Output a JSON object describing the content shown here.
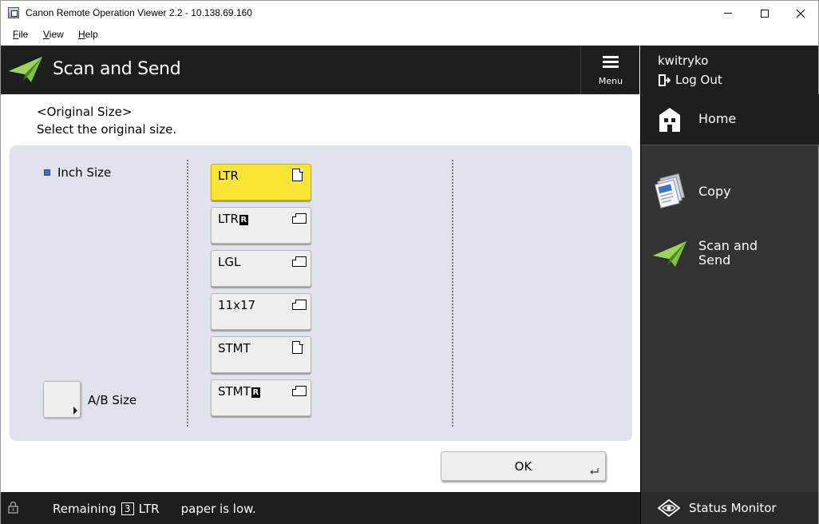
{
  "window": {
    "title": "Canon Remote Operation Viewer 2.2 - 10.138.69.160"
  },
  "menubar": {
    "file": "File",
    "view": "View",
    "help": "Help"
  },
  "header": {
    "title": "Scan and Send",
    "menu_label": "Menu"
  },
  "user": {
    "name": "kwitryko",
    "logout_label": "Log Out"
  },
  "sidebar": {
    "home_label": "Home",
    "copy_label": "Copy",
    "scan_label_line1": "Scan and",
    "scan_label_line2": "Send",
    "status_monitor_label": "Status Monitor"
  },
  "main": {
    "heading": "<Original Size>",
    "instruction": "Select the original size.",
    "inch_size_label": "Inch Size",
    "ab_size_label": "A/B Size",
    "sizes": [
      {
        "label": "LTR",
        "rotated": false,
        "orientation": "portrait",
        "selected": true
      },
      {
        "label": "LTR",
        "rotated": true,
        "orientation": "landscape",
        "selected": false
      },
      {
        "label": "LGL",
        "rotated": false,
        "orientation": "landscape",
        "selected": false
      },
      {
        "label": "11x17",
        "rotated": false,
        "orientation": "landscape",
        "selected": false
      },
      {
        "label": "STMT",
        "rotated": false,
        "orientation": "portrait",
        "selected": false
      },
      {
        "label": "STMT",
        "rotated": true,
        "orientation": "landscape",
        "selected": false
      }
    ],
    "rotated_badge": "R",
    "ok_label": "OK",
    "selected_color": "#fbe636"
  },
  "status": {
    "prefix": "Remaining",
    "count": "3",
    "paper": "LTR",
    "suffix": "paper is low."
  }
}
